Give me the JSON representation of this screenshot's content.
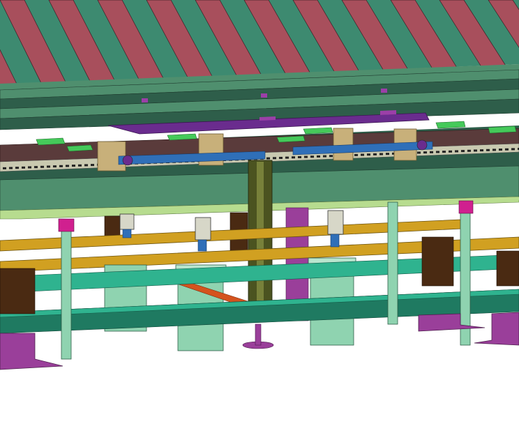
{
  "viewport": {
    "background": "#ffffff"
  },
  "palette": {
    "roof_panel": "#a84f5c",
    "roof_strip": "#3d8a70",
    "beam_green": "#4f8f6e",
    "beam_dark": "#2e5e4a",
    "purple": "#6a2c8e",
    "violet": "#9b3fa8",
    "pad_green": "#45c95a",
    "tan": "#c8b07a",
    "chain_dark": "#5a3b3b",
    "chain_light": "#c9c9b0",
    "shaft_blue": "#2f6fb8",
    "post_olive": "#4b5320",
    "post_olive_light": "#78813a",
    "deck_light": "#b7dc8f",
    "orange_rail": "#d1a021",
    "teal_frame": "#2fb38f",
    "teal_dark": "#1f7a61",
    "cylinder": "#8fd3b0",
    "brown_block": "#4a2a12",
    "magenta": "#d0208f",
    "red_brace": "#d4531e",
    "lavender": "#9a3f9a"
  },
  "parts": [
    "roof-panels",
    "upper-beam",
    "purple-plate",
    "green-pads",
    "chain-conveyor",
    "drive-shaft",
    "center-post",
    "deck-plate",
    "orange-rails",
    "lift-cylinders",
    "base-frame",
    "support-columns",
    "base-feet"
  ]
}
